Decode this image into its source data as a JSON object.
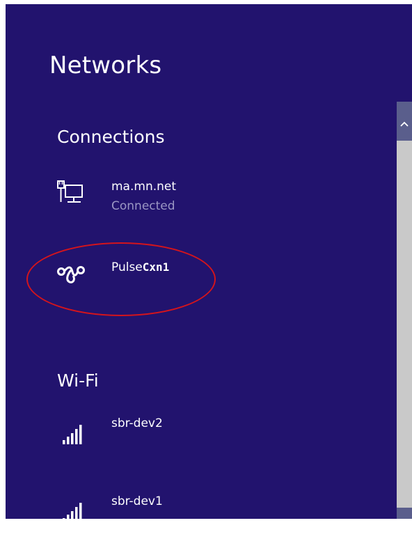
{
  "panel": {
    "title": "Networks"
  },
  "connections": {
    "heading": "Connections",
    "items": [
      {
        "name": "ma.mn.net",
        "status": "Connected",
        "icon": "wired-network-icon"
      },
      {
        "name_prefix": "Pulse",
        "name_suffix": "Cxn1",
        "icon": "vpn-icon"
      }
    ]
  },
  "wifi": {
    "heading": "Wi-Fi",
    "items": [
      {
        "name": "sbr-dev2",
        "icon": "wifi-signal-icon"
      },
      {
        "name": "sbr-dev1",
        "icon": "wifi-signal-icon"
      }
    ]
  },
  "colors": {
    "panel_bg": "#22136e",
    "text": "#ffffff",
    "status_text": "#9b97c4",
    "highlight": "#d4141c",
    "scrollbar_track": "#c9c9c9",
    "scrollbar_button": "#5a5e8c"
  }
}
